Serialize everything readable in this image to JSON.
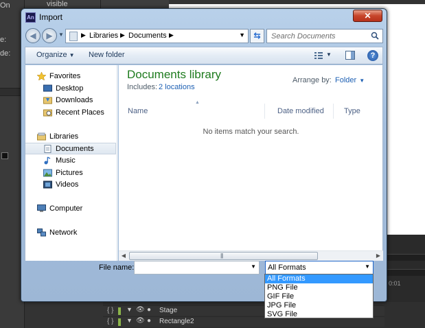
{
  "background": {
    "left_texts": [
      "On",
      "e:",
      "de:"
    ],
    "top_text": "visible",
    "layers": [
      {
        "name": "Stage"
      },
      {
        "name": "Rectangle2"
      }
    ],
    "timeline_mark": "0:01"
  },
  "dialog": {
    "title": "Import",
    "app_icon_text": "An",
    "close_glyph": "✕"
  },
  "address": {
    "parts": [
      "Libraries",
      "Documents"
    ]
  },
  "search": {
    "placeholder": "Search Documents"
  },
  "commandbar": {
    "organize": "Organize",
    "new_folder": "New folder"
  },
  "nav": {
    "favorites": "Favorites",
    "desktop": "Desktop",
    "downloads": "Downloads",
    "recent_places": "Recent Places",
    "libraries": "Libraries",
    "documents": "Documents",
    "music": "Music",
    "pictures": "Pictures",
    "videos": "Videos",
    "computer": "Computer",
    "network": "Network"
  },
  "content": {
    "library_title": "Documents library",
    "includes_label": "Includes:",
    "locations_link": "2 locations",
    "arrange_label": "Arrange by:",
    "arrange_value": "Folder",
    "columns": [
      "Name",
      "Date modified",
      "Type"
    ],
    "empty_message": "No items match your search."
  },
  "footer": {
    "file_name_label": "File name:",
    "file_name_value": "",
    "filter_selected": "All Formats",
    "filter_options": [
      "All Formats",
      "PNG File",
      "GIF File",
      "JPG File",
      "SVG File"
    ]
  },
  "colors": {
    "library_title": "#1e7b1e",
    "link": "#1c5fb3",
    "dropdown_highlight": "#3399ff"
  }
}
